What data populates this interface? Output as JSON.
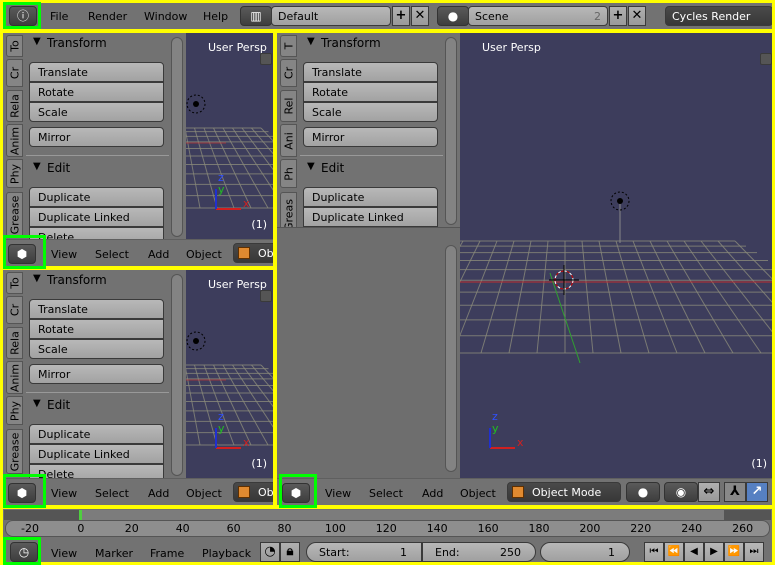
{
  "topbar": {
    "editor_icon": "info-icon",
    "menus": [
      "File",
      "Render",
      "Window",
      "Help"
    ],
    "layout_icon": "screen-layout-icon",
    "layout_value": "Default",
    "scene_icon": "scene-icon",
    "scene_value": "Scene",
    "scene_users": "2",
    "add_symbol": "+",
    "remove_symbol": "✕",
    "render_engine": "Cycles Render"
  },
  "views": [
    {
      "tabs": [
        "To",
        "Cr",
        "Rela",
        "Anim",
        "Phy",
        "Grease"
      ],
      "header_menus": [
        "View",
        "Select",
        "Add",
        "Object"
      ],
      "mode": "Obj"
    },
    {
      "tabs": [
        "To",
        "Cr",
        "Rela",
        "Anim",
        "Phy",
        "Grease"
      ],
      "header_menus": [
        "View",
        "Select",
        "Add",
        "Object"
      ],
      "mode": "Obj"
    },
    {
      "tabs": [
        "T",
        "Cr",
        "Rel",
        "Ani",
        "Ph",
        "Greas"
      ],
      "header_menus": [
        "View",
        "Select",
        "Add",
        "Object"
      ],
      "mode": "Object Mode"
    }
  ],
  "toolshelf": {
    "transform_title": "Transform",
    "transform_buttons": [
      "Translate",
      "Rotate",
      "Scale"
    ],
    "mirror": "Mirror",
    "edit_title": "Edit",
    "edit_buttons": [
      "Duplicate",
      "Duplicate Linked",
      "Delete"
    ]
  },
  "viewport": {
    "label": "User Persp",
    "frame": "(1)",
    "axis_x": "x",
    "axis_y": "y",
    "axis_z": "z",
    "bg_color": "#3d3d5c"
  },
  "timeline": {
    "ticks": [
      "-20",
      "0",
      "20",
      "40",
      "60",
      "80",
      "100",
      "120",
      "140",
      "160",
      "180",
      "200",
      "220",
      "240",
      "260"
    ],
    "menus": [
      "View",
      "Marker",
      "Frame",
      "Playback"
    ],
    "start_label": "Start:",
    "start_value": "1",
    "end_label": "End:",
    "end_value": "250",
    "current_frame": "1",
    "playback_buttons": [
      "⏮",
      "⏪",
      "◀",
      "▶",
      "⏩",
      "⏭"
    ]
  },
  "colors": {
    "highlight_yellow": "#ffff00",
    "highlight_green": "#00ff00",
    "playhead": "#4fcf3f"
  }
}
